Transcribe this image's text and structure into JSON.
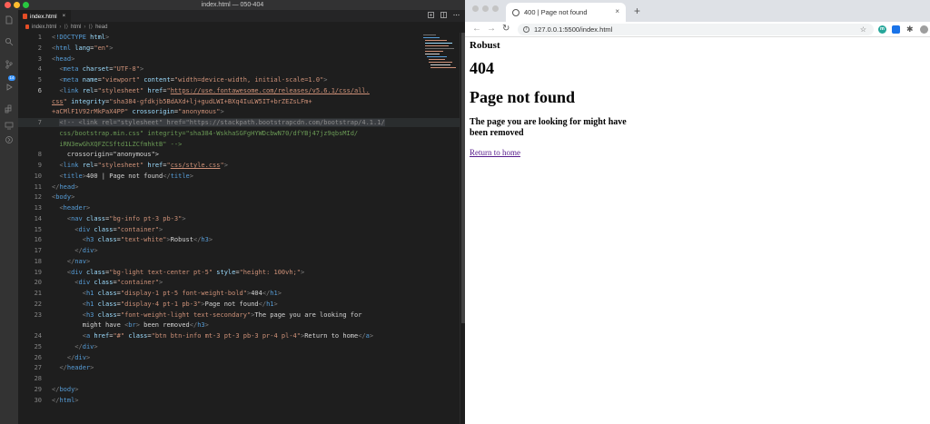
{
  "vscode": {
    "window_title": "index.html — 050-404",
    "tab_label": "index.html",
    "tab_close": "×",
    "breadcrumb": [
      "index.html",
      "html",
      "head"
    ],
    "code_lines": [
      {
        "n": "1",
        "segments": [
          [
            "t",
            "<"
          ],
          [
            "tn",
            "!DOCTYPE"
          ],
          [
            "tx",
            " "
          ],
          [
            "an",
            "html"
          ],
          [
            "t",
            ">"
          ]
        ]
      },
      {
        "n": "2",
        "segments": [
          [
            "t",
            "<"
          ],
          [
            "tn",
            "html"
          ],
          [
            "tx",
            " "
          ],
          [
            "an",
            "lang"
          ],
          [
            "tx",
            "="
          ],
          [
            "av",
            "\"en\""
          ],
          [
            "t",
            ">"
          ]
        ]
      },
      {
        "n": "3",
        "segments": [
          [
            "t",
            "<"
          ],
          [
            "tn",
            "head"
          ],
          [
            "t",
            ">"
          ]
        ]
      },
      {
        "n": "4",
        "segments": [
          [
            "tx",
            "  "
          ],
          [
            "t",
            "<"
          ],
          [
            "tn",
            "meta"
          ],
          [
            "tx",
            " "
          ],
          [
            "an",
            "charset"
          ],
          [
            "tx",
            "="
          ],
          [
            "av",
            "\"UTF-8\""
          ],
          [
            "t",
            ">"
          ]
        ]
      },
      {
        "n": "5",
        "segments": [
          [
            "tx",
            "  "
          ],
          [
            "t",
            "<"
          ],
          [
            "tn",
            "meta"
          ],
          [
            "tx",
            " "
          ],
          [
            "an",
            "name"
          ],
          [
            "tx",
            "="
          ],
          [
            "av",
            "\"viewport\""
          ],
          [
            "tx",
            " "
          ],
          [
            "an",
            "content"
          ],
          [
            "tx",
            "="
          ],
          [
            "av",
            "\"width=device-width, initial-scale=1.0\""
          ],
          [
            "t",
            ">"
          ]
        ]
      },
      {
        "n": "6",
        "segments": [
          [
            "tx",
            "  "
          ],
          [
            "t",
            "<"
          ],
          [
            "tn",
            "link"
          ],
          [
            "tx",
            " "
          ],
          [
            "an",
            "rel"
          ],
          [
            "tx",
            "="
          ],
          [
            "av",
            "\"stylesheet\""
          ],
          [
            "tx",
            " "
          ],
          [
            "an",
            "href"
          ],
          [
            "tx",
            "="
          ],
          [
            "av",
            "\""
          ],
          [
            "avu",
            "https://use.fontawesome.com/releases/v5.6.1/css/all."
          ]
        ]
      },
      {
        "n": "",
        "segments": [
          [
            "avu",
            "css"
          ],
          [
            "av",
            "\""
          ],
          [
            "tx",
            " "
          ],
          [
            "an",
            "integrity"
          ],
          [
            "tx",
            "="
          ],
          [
            "av",
            "\"sha384-gfdkjb5BdAXd+lj+gudLWI+BXq4IuLW5IT+brZEZsLFm+"
          ]
        ]
      },
      {
        "n": "",
        "segments": [
          [
            "av",
            "+aCMlF1V92rMkPaX4PP\""
          ],
          [
            "tx",
            " "
          ],
          [
            "an",
            "crossorigin"
          ],
          [
            "tx",
            "="
          ],
          [
            "av",
            "\"anonymous\""
          ],
          [
            "t",
            ">"
          ]
        ]
      },
      {
        "n": "7",
        "hl": true,
        "segments": [
          [
            "tx",
            "  "
          ],
          [
            "cmbg",
            "<!-- <link rel=\"stylesheet\" href=\"https://stackpath.bootstrapcdn.com/bootstrap/4.1.1/"
          ]
        ]
      },
      {
        "n": "",
        "segments": [
          [
            "cmg",
            "  css/bootstrap.min.css\" integrity=\"sha384-WskhaSGFgHYWDcbwN70/dfYBj47jz9qbsMId/"
          ]
        ]
      },
      {
        "n": "",
        "segments": [
          [
            "cmg",
            "  iRN3ewGhXQFZCSftd1LZCfmhktB\" -->"
          ]
        ]
      },
      {
        "n": "8",
        "segments": [
          [
            "tx",
            "    crossorigin=\"anonymous\">"
          ]
        ]
      },
      {
        "n": "9",
        "segments": [
          [
            "tx",
            "  "
          ],
          [
            "t",
            "<"
          ],
          [
            "tn",
            "link"
          ],
          [
            "tx",
            " "
          ],
          [
            "an",
            "rel"
          ],
          [
            "tx",
            "="
          ],
          [
            "av",
            "\"stylesheet\""
          ],
          [
            "tx",
            " "
          ],
          [
            "an",
            "href"
          ],
          [
            "tx",
            "="
          ],
          [
            "av",
            "\""
          ],
          [
            "avu",
            "css/style.css"
          ],
          [
            "av",
            "\""
          ],
          [
            "t",
            ">"
          ]
        ]
      },
      {
        "n": "10",
        "segments": [
          [
            "tx",
            "  "
          ],
          [
            "t",
            "<"
          ],
          [
            "tn",
            "title"
          ],
          [
            "t",
            ">"
          ],
          [
            "tx",
            "400 | Page not found"
          ],
          [
            "t",
            "</"
          ],
          [
            "tn",
            "title"
          ],
          [
            "t",
            ">"
          ]
        ]
      },
      {
        "n": "11",
        "segments": [
          [
            "t",
            "</"
          ],
          [
            "tn",
            "head"
          ],
          [
            "t",
            ">"
          ]
        ]
      },
      {
        "n": "12",
        "segments": [
          [
            "t",
            "<"
          ],
          [
            "tn",
            "body"
          ],
          [
            "t",
            ">"
          ]
        ]
      },
      {
        "n": "13",
        "segments": [
          [
            "tx",
            "  "
          ],
          [
            "t",
            "<"
          ],
          [
            "tn",
            "header"
          ],
          [
            "t",
            ">"
          ]
        ]
      },
      {
        "n": "14",
        "segments": [
          [
            "tx",
            "    "
          ],
          [
            "t",
            "<"
          ],
          [
            "tn",
            "nav"
          ],
          [
            "tx",
            " "
          ],
          [
            "an",
            "class"
          ],
          [
            "tx",
            "="
          ],
          [
            "av",
            "\"bg-info pt-3 pb-3\""
          ],
          [
            "t",
            ">"
          ]
        ]
      },
      {
        "n": "15",
        "segments": [
          [
            "tx",
            "      "
          ],
          [
            "t",
            "<"
          ],
          [
            "tn",
            "div"
          ],
          [
            "tx",
            " "
          ],
          [
            "an",
            "class"
          ],
          [
            "tx",
            "="
          ],
          [
            "av",
            "\"container\""
          ],
          [
            "t",
            ">"
          ]
        ]
      },
      {
        "n": "16",
        "segments": [
          [
            "tx",
            "        "
          ],
          [
            "t",
            "<"
          ],
          [
            "tn",
            "h3"
          ],
          [
            "tx",
            " "
          ],
          [
            "an",
            "class"
          ],
          [
            "tx",
            "="
          ],
          [
            "av",
            "\"text-white\""
          ],
          [
            "t",
            ">"
          ],
          [
            "tx",
            "Robust"
          ],
          [
            "t",
            "</"
          ],
          [
            "tn",
            "h3"
          ],
          [
            "t",
            ">"
          ]
        ]
      },
      {
        "n": "17",
        "segments": [
          [
            "tx",
            "      "
          ],
          [
            "t",
            "</"
          ],
          [
            "tn",
            "div"
          ],
          [
            "t",
            ">"
          ]
        ]
      },
      {
        "n": "18",
        "segments": [
          [
            "tx",
            "    "
          ],
          [
            "t",
            "</"
          ],
          [
            "tn",
            "nav"
          ],
          [
            "t",
            ">"
          ]
        ]
      },
      {
        "n": "19",
        "segments": [
          [
            "tx",
            "    "
          ],
          [
            "t",
            "<"
          ],
          [
            "tn",
            "div"
          ],
          [
            "tx",
            " "
          ],
          [
            "an",
            "class"
          ],
          [
            "tx",
            "="
          ],
          [
            "av",
            "\"bg-light text-center pt-5\""
          ],
          [
            "tx",
            " "
          ],
          [
            "an",
            "style"
          ],
          [
            "tx",
            "="
          ],
          [
            "av",
            "\"height: 100vh;\""
          ],
          [
            "t",
            ">"
          ]
        ]
      },
      {
        "n": "20",
        "segments": [
          [
            "tx",
            "      "
          ],
          [
            "t",
            "<"
          ],
          [
            "tn",
            "div"
          ],
          [
            "tx",
            " "
          ],
          [
            "an",
            "class"
          ],
          [
            "tx",
            "="
          ],
          [
            "av",
            "\"container\""
          ],
          [
            "t",
            ">"
          ]
        ]
      },
      {
        "n": "21",
        "segments": [
          [
            "tx",
            "        "
          ],
          [
            "t",
            "<"
          ],
          [
            "tn",
            "h1"
          ],
          [
            "tx",
            " "
          ],
          [
            "an",
            "class"
          ],
          [
            "tx",
            "="
          ],
          [
            "av",
            "\"display-1 pt-5 font-weight-bold\""
          ],
          [
            "t",
            ">"
          ],
          [
            "tx",
            "404"
          ],
          [
            "t",
            "</"
          ],
          [
            "tn",
            "h1"
          ],
          [
            "t",
            ">"
          ]
        ]
      },
      {
        "n": "22",
        "segments": [
          [
            "tx",
            "        "
          ],
          [
            "t",
            "<"
          ],
          [
            "tn",
            "h1"
          ],
          [
            "tx",
            " "
          ],
          [
            "an",
            "class"
          ],
          [
            "tx",
            "="
          ],
          [
            "av",
            "\"display-4 pt-1 pb-3\""
          ],
          [
            "t",
            ">"
          ],
          [
            "tx",
            "Page not found"
          ],
          [
            "t",
            "</"
          ],
          [
            "tn",
            "h1"
          ],
          [
            "t",
            ">"
          ]
        ]
      },
      {
        "n": "23",
        "segments": [
          [
            "tx",
            "        "
          ],
          [
            "t",
            "<"
          ],
          [
            "tn",
            "h3"
          ],
          [
            "tx",
            " "
          ],
          [
            "an",
            "class"
          ],
          [
            "tx",
            "="
          ],
          [
            "av",
            "\"font-weight-light text-secondary\""
          ],
          [
            "t",
            ">"
          ],
          [
            "tx",
            "The page you are looking for"
          ]
        ]
      },
      {
        "n": "",
        "segments": [
          [
            "tx",
            "        might have "
          ],
          [
            "t",
            "<"
          ],
          [
            "tn",
            "br"
          ],
          [
            "t",
            ">"
          ],
          [
            "tx",
            " been removed"
          ],
          [
            "t",
            "</"
          ],
          [
            "tn",
            "h3"
          ],
          [
            "t",
            ">"
          ]
        ]
      },
      {
        "n": "24",
        "segments": [
          [
            "tx",
            "        "
          ],
          [
            "t",
            "<"
          ],
          [
            "tn",
            "a"
          ],
          [
            "tx",
            " "
          ],
          [
            "an",
            "href"
          ],
          [
            "tx",
            "="
          ],
          [
            "av",
            "\"#\""
          ],
          [
            "tx",
            " "
          ],
          [
            "an",
            "class"
          ],
          [
            "tx",
            "="
          ],
          [
            "av",
            "\"btn btn-info mt-3 pt-3 pb-3 pr-4 pl-4\""
          ],
          [
            "t",
            ">"
          ],
          [
            "tx",
            "Return to home"
          ],
          [
            "t",
            "</"
          ],
          [
            "tn",
            "a"
          ],
          [
            "t",
            ">"
          ]
        ]
      },
      {
        "n": "25",
        "segments": [
          [
            "tx",
            "      "
          ],
          [
            "t",
            "</"
          ],
          [
            "tn",
            "div"
          ],
          [
            "t",
            ">"
          ]
        ]
      },
      {
        "n": "26",
        "segments": [
          [
            "tx",
            "    "
          ],
          [
            "t",
            "</"
          ],
          [
            "tn",
            "div"
          ],
          [
            "t",
            ">"
          ]
        ]
      },
      {
        "n": "27",
        "segments": [
          [
            "tx",
            "  "
          ],
          [
            "t",
            "</"
          ],
          [
            "tn",
            "header"
          ],
          [
            "t",
            ">"
          ]
        ]
      },
      {
        "n": "28",
        "segments": [
          [
            "tx",
            ""
          ]
        ]
      },
      {
        "n": "29",
        "segments": [
          [
            "t",
            "</"
          ],
          [
            "tn",
            "body"
          ],
          [
            "t",
            ">"
          ]
        ]
      },
      {
        "n": "30",
        "segments": [
          [
            "t",
            "</"
          ],
          [
            "tn",
            "html"
          ],
          [
            "t",
            ">"
          ]
        ]
      }
    ],
    "source_control_badge": "14"
  },
  "chrome": {
    "tab_title": "400 | Page not found",
    "tab_close": "×",
    "new_tab": "+",
    "nav": {
      "back": "←",
      "forward": "→",
      "reload": "↻"
    },
    "address": "127.0.0.1:5500/index.html",
    "star": "☆",
    "ext_m_label": "m",
    "page": {
      "brand": "Robust",
      "code": "404",
      "heading": "Page not found",
      "message_line1": "The page you are looking for might have",
      "message_line2": "been removed",
      "link": "Return to home"
    }
  }
}
